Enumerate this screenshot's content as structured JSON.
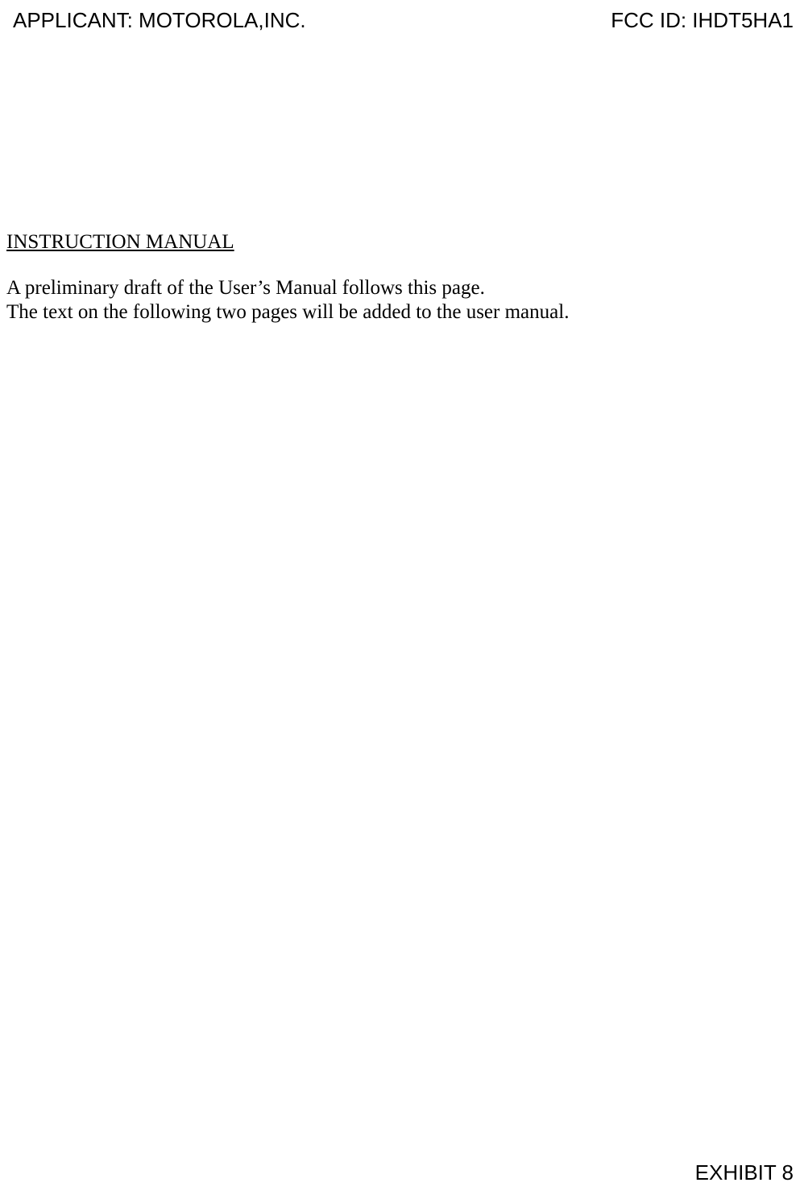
{
  "header": {
    "applicant": "APPLICANT: MOTOROLA,INC.",
    "fccId": "FCC ID: IHDT5HA1"
  },
  "content": {
    "sectionTitle": "INSTRUCTION MANUAL",
    "paragraph1": "A preliminary draft of the User’s Manual follows this page.",
    "paragraph2": "The text on the following two pages will be added to the user manual."
  },
  "footer": {
    "exhibit": "EXHIBIT 8"
  }
}
